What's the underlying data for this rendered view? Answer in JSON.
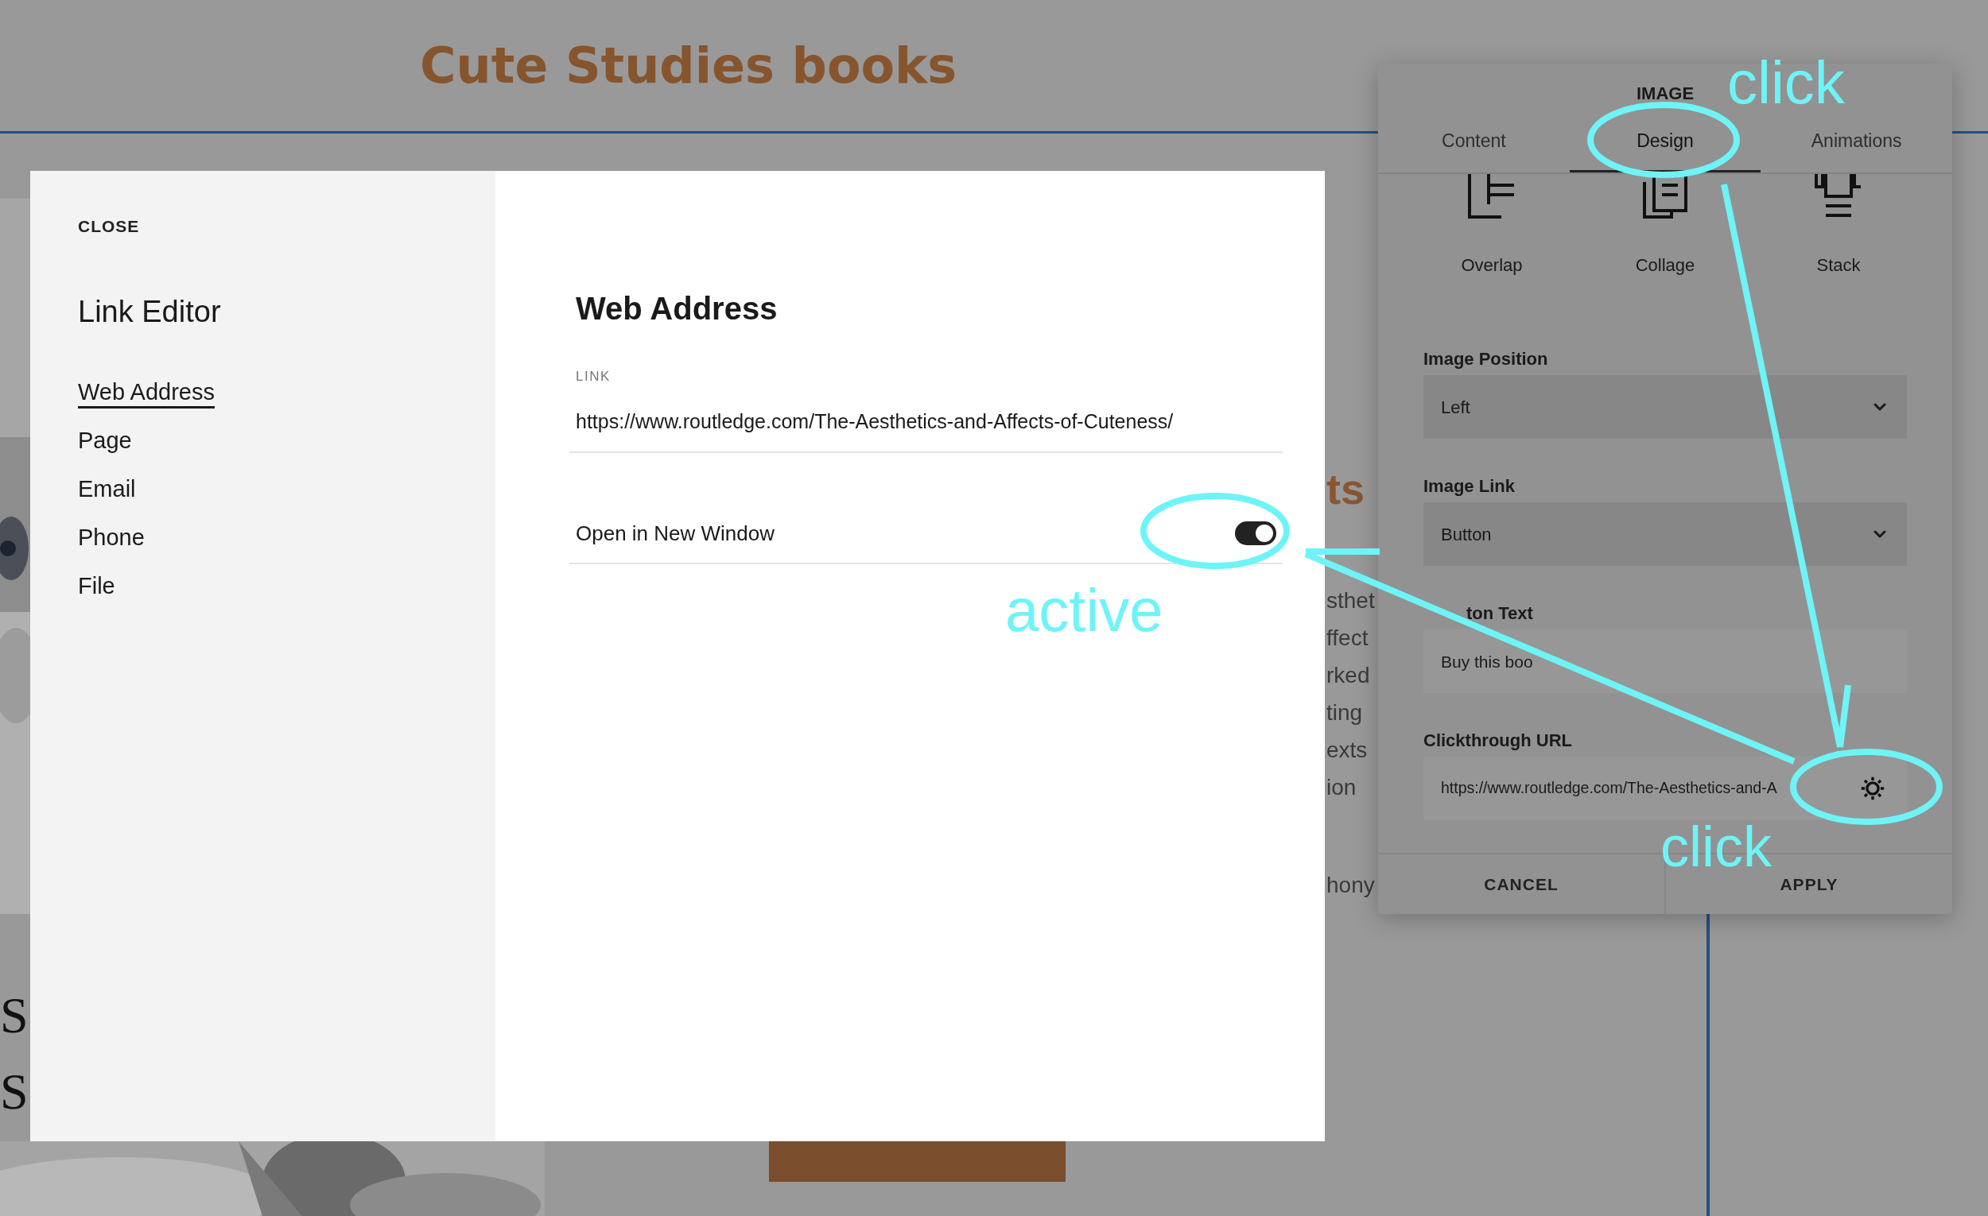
{
  "page_header": {
    "title": "Cute Studies books"
  },
  "background_fragments": {
    "heading": "ts",
    "body_lines": [
      "sthet",
      "ffect",
      "rked",
      "ting",
      "exts",
      "ion"
    ],
    "closing": "hony",
    "serif_lines": [
      "S",
      "S"
    ]
  },
  "link_editor": {
    "close": "CLOSE",
    "title": "Link Editor",
    "nav": [
      {
        "label": "Web Address",
        "selected": true
      },
      {
        "label": "Page",
        "selected": false
      },
      {
        "label": "Email",
        "selected": false
      },
      {
        "label": "Phone",
        "selected": false
      },
      {
        "label": "File",
        "selected": false
      }
    ],
    "section_title": "Web Address",
    "link_label": "LINK",
    "link_value": "https://www.routledge.com/The-Aesthetics-and-Affects-of-Cuteness/",
    "new_window": {
      "label": "Open in New Window",
      "on": true
    }
  },
  "image_panel": {
    "title": "IMAGE",
    "tabs": [
      {
        "label": "Content",
        "selected": false
      },
      {
        "label": "Design",
        "selected": true
      },
      {
        "label": "Animations",
        "selected": false
      }
    ],
    "layouts": [
      {
        "label": "Overlap",
        "kind": "overlap"
      },
      {
        "label": "Collage",
        "kind": "collage"
      },
      {
        "label": "Stack",
        "kind": "stack"
      }
    ],
    "fields": [
      {
        "label": "Image Position",
        "kind": "select",
        "value": "Left"
      },
      {
        "label": "Image Link",
        "kind": "select",
        "value": "Button"
      },
      {
        "label": "ton Text",
        "kind": "text",
        "value": "Buy this boo"
      },
      {
        "label": "Clickthrough URL",
        "kind": "url",
        "value": "https://www.routledge.com/The-Aesthetics-and-A"
      }
    ],
    "buttons": [
      "CANCEL",
      "APPLY"
    ]
  },
  "annotations": [
    {
      "text": "click"
    },
    {
      "text": "active"
    },
    {
      "text": "click"
    }
  ]
}
